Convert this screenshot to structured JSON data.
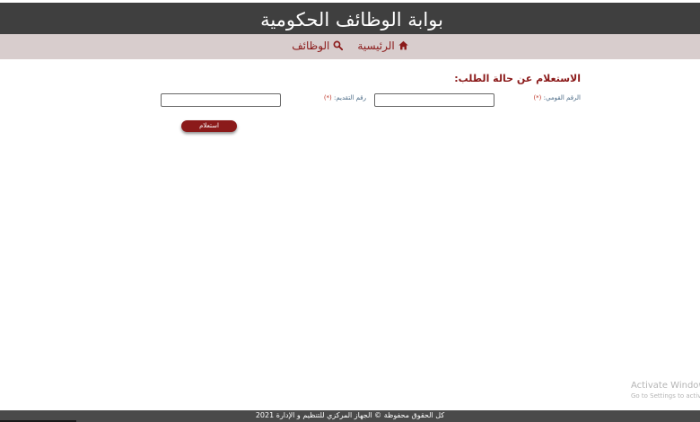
{
  "header": {
    "title": "بوابة الوظائف الحكومية"
  },
  "nav": {
    "home_label": "الرئيسية",
    "home_icon": "home-icon",
    "jobs_label": "الوظائف",
    "jobs_icon": "search-icon"
  },
  "form": {
    "title": "الاستعلام عن حالة الطلب:",
    "national_id_label": "الرقم القومي:",
    "application_number_label": "رقم التقديم:",
    "required_marker": "(*)",
    "national_id_value": "",
    "application_number_value": "",
    "submit_label": "استعلام"
  },
  "watermark": {
    "title": "Activate Windows",
    "subtitle": "Go to Settings to activate"
  },
  "footer": {
    "text": "كل الحقوق محفوظة © الجهاز المركزي للتنظيم و الإدارة 2021"
  },
  "colors": {
    "header_bg": "#3f3f3f",
    "nav_bg": "#d8cdcd",
    "accent": "#8b1a1a",
    "label": "#4a6a86",
    "required": "#c0392b",
    "footer_bg": "#4a4a4a"
  }
}
